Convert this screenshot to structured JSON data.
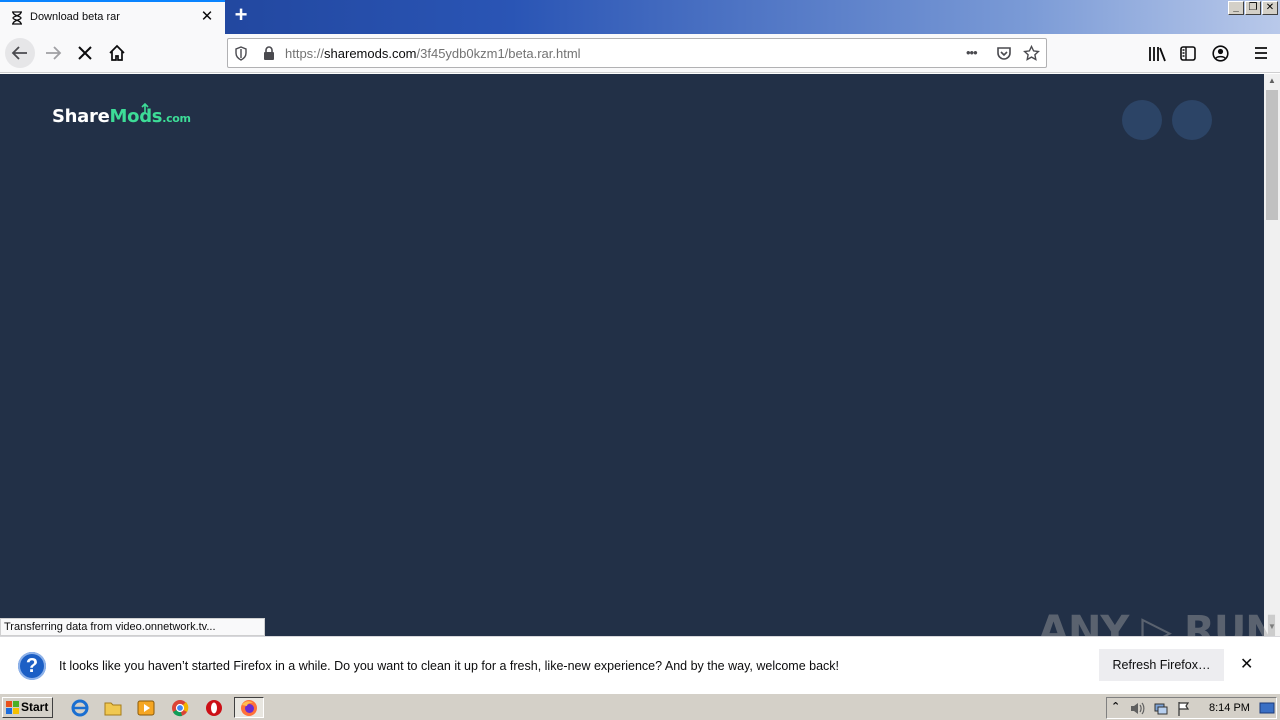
{
  "browser": {
    "tab": {
      "title": "Download beta rar",
      "close": "✕"
    },
    "newtab_label": "+",
    "window_buttons": [
      "_",
      "❐",
      "✕"
    ],
    "url": {
      "prefix": "https://",
      "host": "sharemods.com",
      "path": "/3f45ydb0kzm1/beta.rar.html"
    },
    "url_more": "•••"
  },
  "page": {
    "logo": {
      "share": "Share",
      "mods": "Mods",
      "com": ".com"
    },
    "colors": {
      "background": "#223047",
      "accent": "#3ddc97",
      "circle": "#2c4466"
    }
  },
  "status_text": "Transferring data from video.onnetwork.tv...",
  "notification": {
    "icon": "?",
    "message": "It looks like you haven’t started Firefox in a while. Do you want to clean it up for a fresh, like-new experience? And by the way, welcome back!",
    "button": "Refresh Firefox…",
    "close": "✕"
  },
  "watermark": "ANY ▷ RUN",
  "taskbar": {
    "start_label": "Start",
    "clock": "8:14 PM"
  }
}
